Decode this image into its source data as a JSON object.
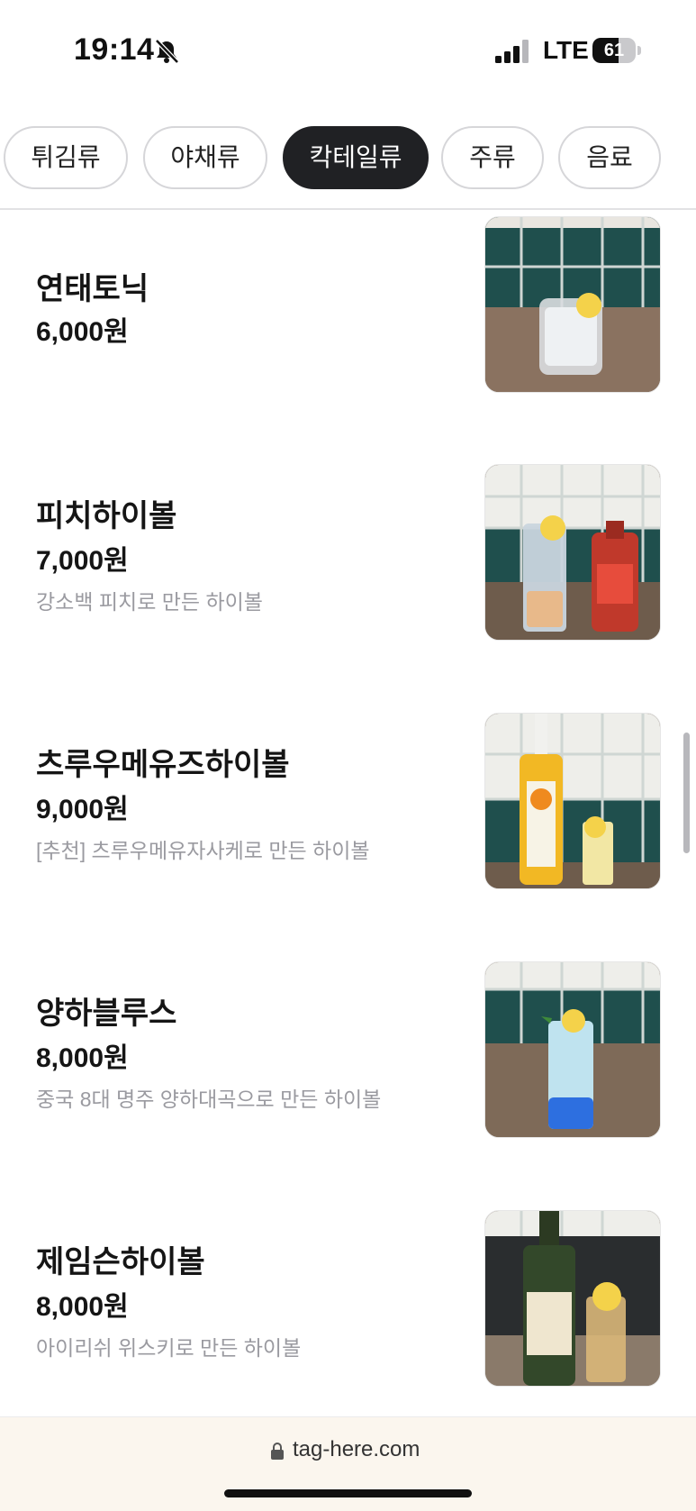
{
  "status_bar": {
    "time": "19:14",
    "network": "LTE",
    "battery_level": "61",
    "battery_fraction": 0.61,
    "icons": [
      "bell-slash-icon",
      "cellular-signal-icon",
      "battery-icon"
    ]
  },
  "tabs": [
    {
      "label": "튀김류",
      "active": false
    },
    {
      "label": "야채류",
      "active": false
    },
    {
      "label": "칵테일류",
      "active": true
    },
    {
      "label": "주류",
      "active": false
    },
    {
      "label": "음료",
      "active": false
    }
  ],
  "menu": {
    "items": [
      {
        "name": "연태토닉",
        "price": "6,000원",
        "description": ""
      },
      {
        "name": "피치하이볼",
        "price": "7,000원",
        "description": "강소백 피치로 만든 하이볼"
      },
      {
        "name": "츠루우메유즈하이볼",
        "price": "9,000원",
        "description": "[추천] 츠루우메유자사케로 만든 하이볼"
      },
      {
        "name": "양하블루스",
        "price": "8,000원",
        "description": "중국 8대 명주 양하대곡으로 만든 하이볼"
      },
      {
        "name": "제임슨하이볼",
        "price": "8,000원",
        "description": "아이리쉬 위스키로 만든 하이볼"
      }
    ]
  },
  "browser": {
    "url": "tag-here.com"
  },
  "colors": {
    "active_tab_bg": "#202124",
    "description_text": "#9a9aa0",
    "url_bar_bg": "#fbf6ee",
    "tile_green": "#1f4f4d"
  }
}
